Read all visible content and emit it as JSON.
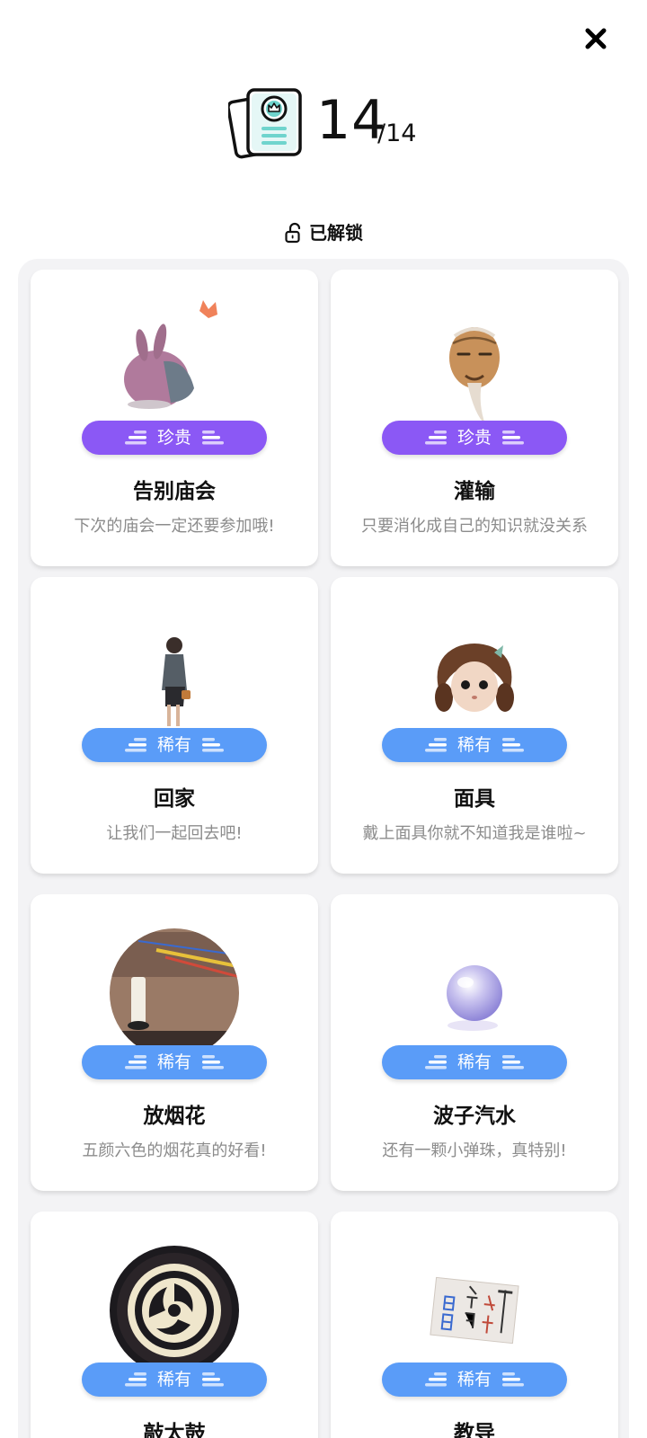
{
  "header": {
    "count": "14",
    "total": "/14"
  },
  "unlock": {
    "label": "已解锁"
  },
  "cards": [
    {
      "badge": "珍贵",
      "title": "告别庙会",
      "desc": "下次的庙会一定还要参加哦!",
      "rarity": "precious",
      "icon": "rabbit-figure-icon"
    },
    {
      "badge": "珍贵",
      "title": "灌输",
      "desc": "只要消化成自己的知识就没关系",
      "rarity": "precious",
      "icon": "old-man-mask-icon"
    },
    {
      "badge": "稀有",
      "title": "回家",
      "desc": "让我们一起回去吧!",
      "rarity": "rare",
      "icon": "girl-figure-icon"
    },
    {
      "badge": "稀有",
      "title": "面具",
      "desc": "戴上面具你就不知道我是谁啦~",
      "rarity": "rare",
      "icon": "doll-mask-icon"
    },
    {
      "badge": "稀有",
      "title": "放烟花",
      "desc": "五颜六色的烟花真的好看!",
      "rarity": "rare",
      "icon": "fireworks-candle-icon"
    },
    {
      "badge": "稀有",
      "title": "波子汽水",
      "desc": "还有一颗小弹珠，真特别!",
      "rarity": "rare",
      "icon": "marble-icon"
    },
    {
      "badge": "稀有",
      "title": "敲太鼓",
      "desc": "",
      "rarity": "rare",
      "icon": "taiko-drum-icon"
    },
    {
      "badge": "稀有",
      "title": "教导",
      "desc": "",
      "rarity": "rare",
      "icon": "calligraphy-paper-icon"
    }
  ],
  "colors": {
    "precious": "#8b58f5",
    "rare": "#5a9cf8",
    "panel": "#f3f3f5"
  }
}
